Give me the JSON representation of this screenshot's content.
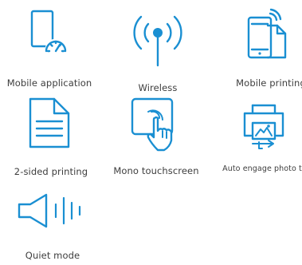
{
  "features": [
    {
      "label": "Mobile application",
      "icon": "mobile-app-gauge-icon"
    },
    {
      "label": "Wireless",
      "icon": "wireless-antenna-icon"
    },
    {
      "label": "Mobile printing",
      "icon": "mobile-printing-icon"
    },
    {
      "label": "2-sided printing",
      "icon": "duplex-document-icon"
    },
    {
      "label": "Mono touchscreen",
      "icon": "touchscreen-hand-icon"
    },
    {
      "label": "Auto engage photo tr",
      "icon": "photo-tray-printer-icon"
    },
    {
      "label": "Quiet mode",
      "icon": "quiet-mode-speaker-icon"
    }
  ],
  "colors": {
    "icon": "#1a8fd2",
    "text": "#3d3d3d",
    "background": "#ffffff"
  }
}
